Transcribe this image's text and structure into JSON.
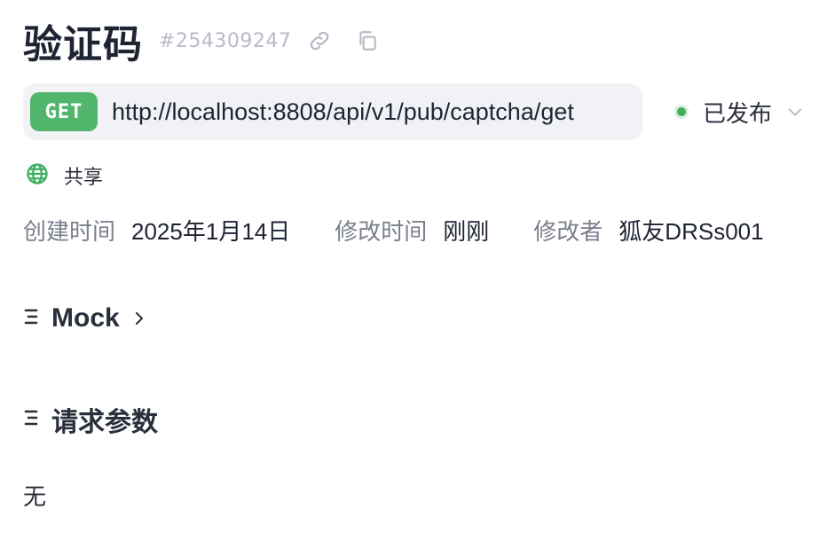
{
  "page": {
    "title": "验证码",
    "id_label": "#254309247"
  },
  "request": {
    "method": "GET",
    "url": "http://localhost:8808/api/v1/pub/captcha/get",
    "method_color": "#52b56c"
  },
  "status": {
    "label": "已发布",
    "dot_color": "#3fae5f"
  },
  "share": {
    "label": "共享"
  },
  "meta": {
    "created_label": "创建时间",
    "created_value": "2025年1月14日",
    "modified_label": "修改时间",
    "modified_value": "刚刚",
    "modifier_label": "修改者",
    "modifier_value": "狐友DRSs001"
  },
  "sections": {
    "mock_title": "Mock",
    "params_title": "请求参数",
    "params_empty": "无"
  },
  "icons": {
    "link": "link-icon",
    "copy": "copy-icon",
    "globe": "globe-icon",
    "chevron_down": "chevron-down-icon",
    "chevron_right": "chevron-right-icon",
    "section": "section-lines-icon"
  }
}
